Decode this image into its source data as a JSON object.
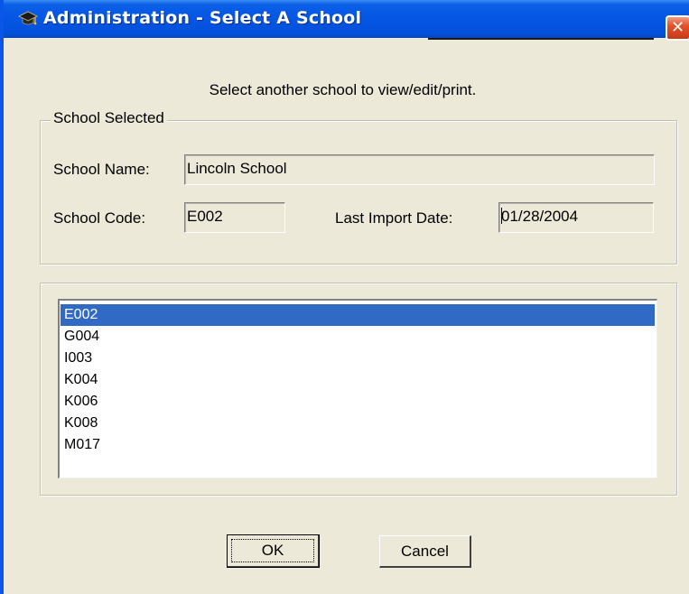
{
  "window": {
    "title": "Administration - Select A School",
    "close_label": "✕",
    "icon": "graduation-cap-icon"
  },
  "instruction": "Select another school to view/edit/print.",
  "school_selected": {
    "legend": "School Selected",
    "name_label": "School Name:",
    "name_value": "Lincoln School",
    "code_label": "School Code:",
    "code_value": "E002",
    "import_label": "Last Import Date:",
    "import_value": "01/28/2004"
  },
  "school_list": {
    "items": [
      "E002",
      "G004",
      "I003",
      "K004",
      "K006",
      "K008",
      "M017"
    ],
    "selected_index": 0
  },
  "buttons": {
    "ok_label": "OK",
    "cancel_label": "Cancel"
  },
  "colors": {
    "title_bar": "#0556e4",
    "selection": "#316ac5",
    "dialog_bg": "#ece9d8",
    "close_button": "#e3512b"
  }
}
